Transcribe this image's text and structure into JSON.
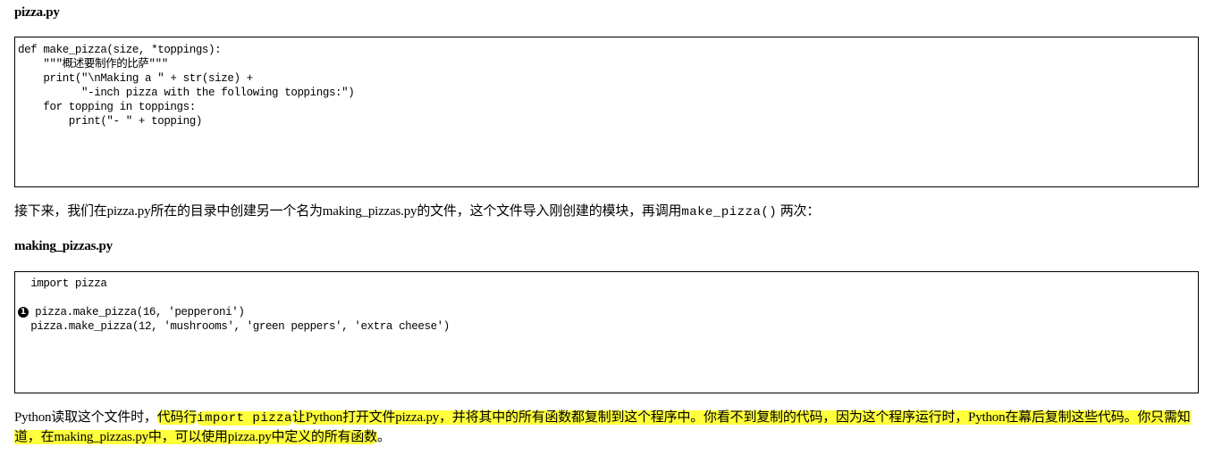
{
  "section1": {
    "title": "pizza.py",
    "code": "def make_pizza(size, *toppings):\n    \"\"\"概述要制作的比萨\"\"\"\n    print(\"\\nMaking a \" + str(size) +\n          \"-inch pizza with the following toppings:\")\n    for topping in toppings:\n        print(\"- \" + topping)"
  },
  "intro": {
    "text": "接下来，我们在pizza.py所在的目录中创建另一个名为making_pizzas.py的文件，这个文件导入刚创建的模块，再调用",
    "code": "make_pizza()",
    "suffix": " 两次："
  },
  "section2": {
    "title": "making_pizzas.py",
    "line1": "  import pizza",
    "marker": "1",
    "line2": " pizza.make_pizza(16, 'pepperoni')",
    "line3": "  pizza.make_pizza(12, 'mushrooms', 'green peppers', 'extra cheese')"
  },
  "explanation": {
    "lead": "Python读取这个文件时，",
    "hl_a": "代码行",
    "code": "import pizza",
    "hl_b": "让Python打开文件pizza.py，并将其中的所有函数都复制到这个程序中。你看不到复制的代码，因为这个程序运行时，Python在幕后复制这些代码。你只需知道，在making_pizzas.py中，可以使用pizza.py中定义的所有函数",
    "tail": "。"
  },
  "colors": {
    "highlight": "#ffff3c"
  }
}
